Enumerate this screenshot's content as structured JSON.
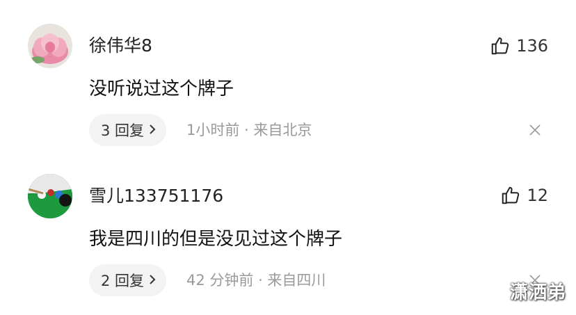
{
  "comments": [
    {
      "username": "徐伟华8",
      "likes": "136",
      "text": "没听说过这个牌子",
      "reply_label": "3 回复",
      "meta": "1小时前 · 来自北京"
    },
    {
      "username": "雪儿133751176",
      "likes": "12",
      "text": "我是四川的但是没见过这个牌子",
      "reply_label": "2 回复",
      "meta": "42 分钟前 · 来自四川"
    }
  ],
  "watermark": "潇洒弟",
  "icons": [
    "thumbs-up-icon",
    "chevron-right-icon",
    "close-icon"
  ]
}
